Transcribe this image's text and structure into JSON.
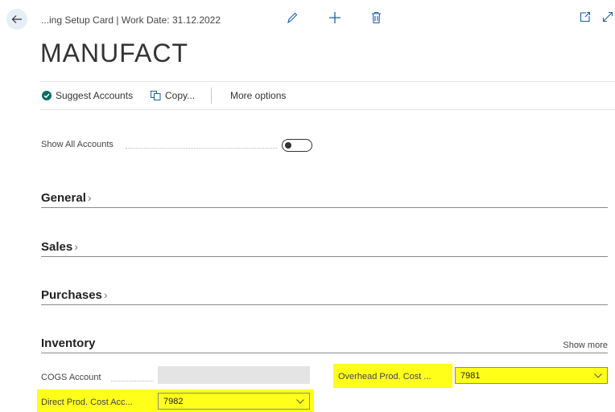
{
  "header": {
    "title": "...ing Setup Card | Work Date: 31.12.2022",
    "page_title": "MANUFACT"
  },
  "actions": {
    "suggest_accounts": "Suggest Accounts",
    "copy": "Copy...",
    "more_options": "More options"
  },
  "show_all_accounts": {
    "label": "Show All Accounts",
    "checked": false
  },
  "sections": {
    "general": "General",
    "sales": "Sales",
    "purchases": "Purchases",
    "inventory": "Inventory",
    "show_more": "Show more"
  },
  "inventory_fields": {
    "cogs_label": "COGS Account",
    "cogs_value": "",
    "overhead_label": "Overhead Prod. Cost ...",
    "overhead_value": "7981",
    "direct_label": "Direct Prod. Cost Acc...",
    "direct_value": "7982"
  },
  "colors": {
    "highlight": "#ffff1a",
    "accent": "#0b6a66",
    "toolbar_icon": "#1a5ea8"
  }
}
